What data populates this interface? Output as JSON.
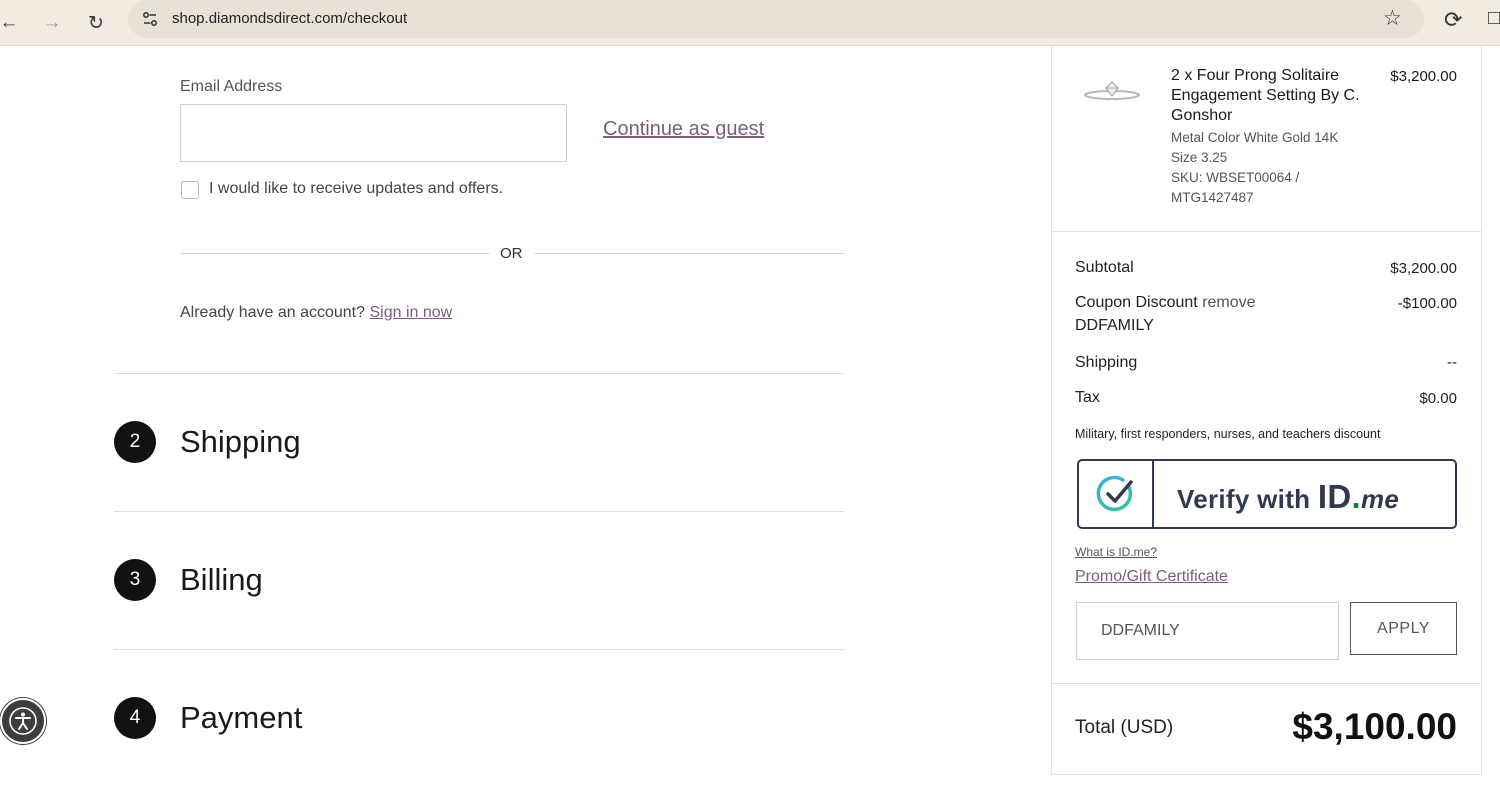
{
  "browser": {
    "url": "shop.diamondsdirect.com/checkout"
  },
  "account": {
    "email_label": "Email Address",
    "email_value": "",
    "continue_guest": "Continue as guest",
    "updates_label": "I would like to receive updates and offers.",
    "or_text": "OR",
    "already_text": "Already have an account?",
    "signin_link": "Sign in now"
  },
  "steps": [
    {
      "number": "2",
      "title": "Shipping"
    },
    {
      "number": "3",
      "title": "Billing"
    },
    {
      "number": "4",
      "title": "Payment"
    }
  ],
  "summary": {
    "product": {
      "name": "2 x Four Prong Solitaire Engagement Setting By C. Gonshor",
      "price": "$3,200.00",
      "metal": "Metal Color White Gold 14K",
      "size": "Size 3.25",
      "sku_line1": "SKU: WBSET00064 /",
      "sku_line2": "MTG1427487"
    },
    "subtotal_label": "Subtotal",
    "subtotal_value": "$3,200.00",
    "coupon_label": "Coupon Discount",
    "coupon_remove": "remove",
    "coupon_code": "DDFAMILY",
    "coupon_value": "-$100.00",
    "shipping_label": "Shipping",
    "shipping_value": "--",
    "tax_label": "Tax",
    "tax_value": "$0.00",
    "military_text": "Military, first responders, nurses, and teachers discount",
    "idme_verify": "Verify with",
    "idme_logo_id": "ID",
    "idme_logo_dot": ".",
    "idme_logo_me": "me",
    "whatis_link": "What is ID.me?",
    "promo_link": "Promo/Gift Certificate",
    "promo_value": "DDFAMILY",
    "apply_button": "APPLY",
    "total_label": "Total (USD)",
    "total_value": "$3,100.00"
  },
  "colors": {
    "link": "#7e5d7e",
    "idme_navy": "#2e3b4e",
    "idme_green": "#08833d"
  }
}
